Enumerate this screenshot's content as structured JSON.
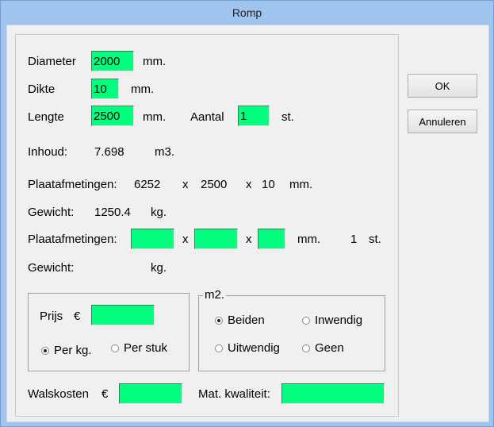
{
  "window": {
    "title": "Romp"
  },
  "dimensions": {
    "diameter_label": "Diameter",
    "diameter_value": "2000",
    "diameter_unit": "mm.",
    "dikte_label": "Dikte",
    "dikte_value": "10",
    "dikte_unit": "mm.",
    "lengte_label": "Lengte",
    "lengte_value": "2500",
    "lengte_unit": "mm.",
    "aantal_label": "Aantal",
    "aantal_value": "1",
    "aantal_unit": "st."
  },
  "results": {
    "inhoud_label": "Inhoud:",
    "inhoud_value": "7.698",
    "inhoud_unit": "m3.",
    "plaat1_label": "Plaatafmetingen:",
    "plaat1_a": "6252",
    "plaat1_x1": "x",
    "plaat1_b": "2500",
    "plaat1_x2": "x",
    "plaat1_c": "10",
    "plaat1_unit": "mm.",
    "gewicht1_label": "Gewicht:",
    "gewicht1_value": "1250.4",
    "gewicht1_unit": "kg.",
    "plaat2_label": "Plaatafmetingen:",
    "plaat2_x1": "x",
    "plaat2_x2": "x",
    "plaat2_unit": "mm.",
    "plaat2_count": "1",
    "plaat2_count_unit": "st.",
    "gewicht2_label": "Gewicht:",
    "gewicht2_unit": "kg."
  },
  "prijs": {
    "label": "Prijs",
    "currency": "€",
    "value": "",
    "per_kg_label": "Per kg.",
    "per_stuk_label": "Per stuk",
    "selected": "per_kg"
  },
  "m2": {
    "title": "m2.",
    "beiden_label": "Beiden",
    "inwendig_label": "Inwendig",
    "uitwendig_label": "Uitwendig",
    "geen_label": "Geen",
    "selected": "beiden"
  },
  "bottom": {
    "walskosten_label": "Walskosten",
    "walskosten_currency": "€",
    "walskosten_value": "",
    "mat_label": "Mat. kwaliteit:",
    "mat_value": ""
  },
  "buttons": {
    "ok_label": "OK",
    "cancel_label": "Annuleren"
  },
  "colors": {
    "field": "#00ff7f",
    "titlebar": "#9fc5ef"
  }
}
